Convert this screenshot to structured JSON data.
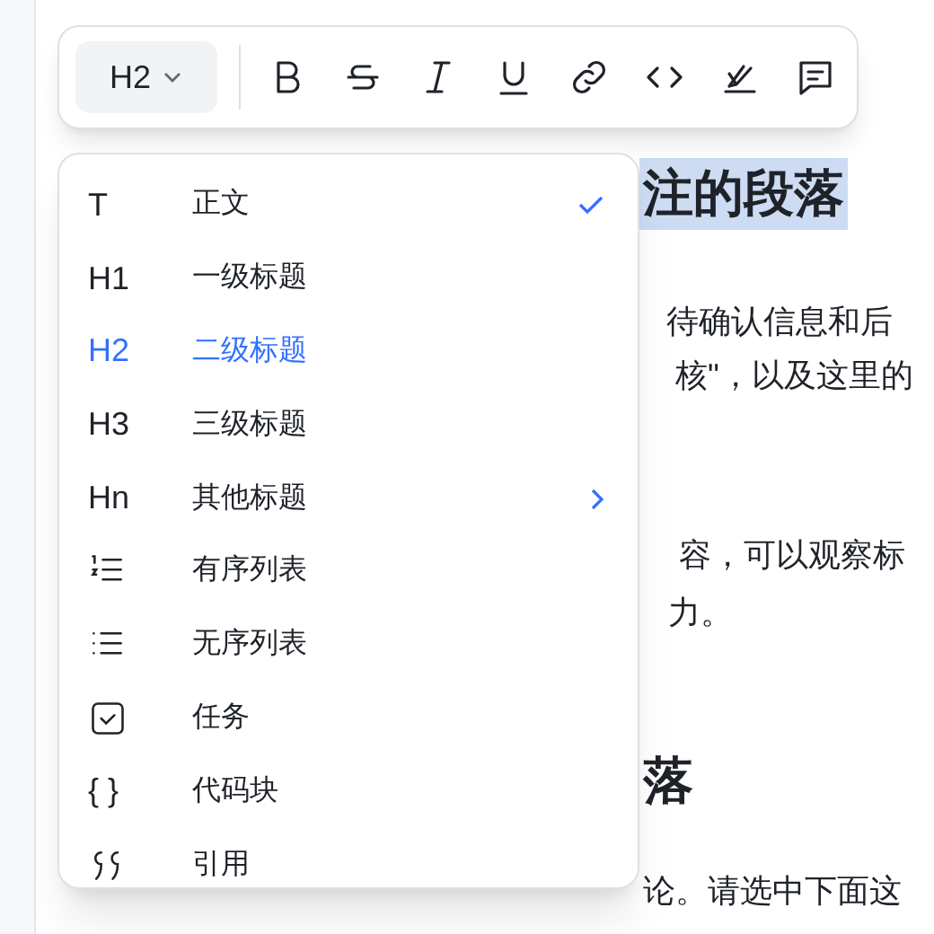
{
  "document": {
    "heading_1": "注的段落",
    "paragraph_lines": [
      "待确认信息和后",
      "核\"，以及这里的",
      "容，可以观察标",
      "力。"
    ],
    "heading_2": "落",
    "last_line": "论。请选中下面这"
  },
  "toolbar": {
    "block_type": "H2"
  },
  "menu": {
    "items": [
      {
        "kind": "glyph",
        "icon_text": "T",
        "label": "正文",
        "checked": true,
        "highlighted": false,
        "has_submenu": false
      },
      {
        "kind": "glyph",
        "icon_text": "H1",
        "label": "一级标题",
        "checked": false,
        "highlighted": false,
        "has_submenu": false
      },
      {
        "kind": "glyph",
        "icon_text": "H2",
        "label": "二级标题",
        "checked": false,
        "highlighted": true,
        "has_submenu": false
      },
      {
        "kind": "glyph",
        "icon_text": "H3",
        "label": "三级标题",
        "checked": false,
        "highlighted": false,
        "has_submenu": false
      },
      {
        "kind": "glyph",
        "icon_text": "Hn",
        "label": "其他标题",
        "checked": false,
        "highlighted": false,
        "has_submenu": true
      },
      {
        "kind": "ordered-list",
        "label": "有序列表",
        "checked": false,
        "highlighted": false,
        "has_submenu": false
      },
      {
        "kind": "bullet-list",
        "label": "无序列表",
        "checked": false,
        "highlighted": false,
        "has_submenu": false
      },
      {
        "kind": "task",
        "label": "任务",
        "checked": false,
        "highlighted": false,
        "has_submenu": false
      },
      {
        "kind": "glyph",
        "icon_text": "{ }",
        "label": "代码块",
        "checked": false,
        "highlighted": false,
        "has_submenu": false
      },
      {
        "kind": "quote",
        "label": "引用",
        "checked": false,
        "highlighted": false,
        "has_submenu": false
      }
    ]
  }
}
